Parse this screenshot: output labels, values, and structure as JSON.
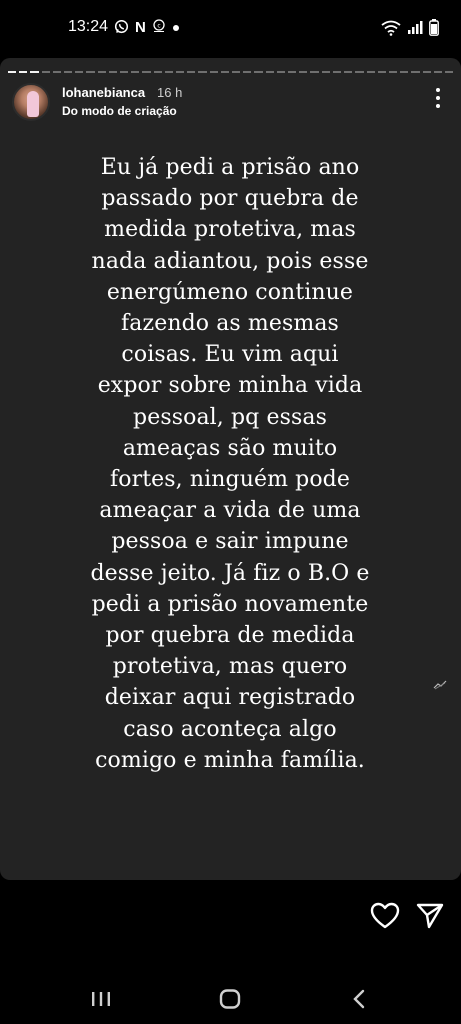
{
  "status_bar": {
    "time": "13:24",
    "left_icons": [
      "whatsapp-icon",
      "netflix-icon",
      "copyright-icon",
      "notification-dot-icon"
    ],
    "right_icons": [
      "wifi-icon",
      "signal-icon",
      "battery-icon"
    ]
  },
  "story": {
    "progress_segments": 40,
    "progress_done": 3,
    "username": "lohanebianca",
    "time_ago": "16 h",
    "subtitle": "Do modo de criação",
    "lines": [
      "Eu já pedi a prisão ano",
      "passado por quebra de",
      "medida protetiva, mas",
      "nada adiantou, pois esse",
      "energúmeno continue",
      "fazendo as mesmas",
      "coisas. Eu vim aqui",
      "expor sobre minha vida",
      "pessoal, pq essas",
      "ameaças são muito",
      "fortes, ninguém pode",
      "ameaçar a vida de uma",
      "pessoa e sair impune",
      "desse jeito. Já fiz o B.O e",
      "pedi a prisão novamente",
      "por quebra de medida",
      "protetiva, mas quero",
      "deixar aqui registrado",
      "caso aconteça algo",
      "comigo e minha família."
    ],
    "background_color": "#232323"
  },
  "actions": {
    "like_icon": "heart-icon",
    "share_icon": "send-icon"
  },
  "navigation": {
    "icons": [
      "recents-icon",
      "home-icon",
      "back-icon"
    ]
  }
}
